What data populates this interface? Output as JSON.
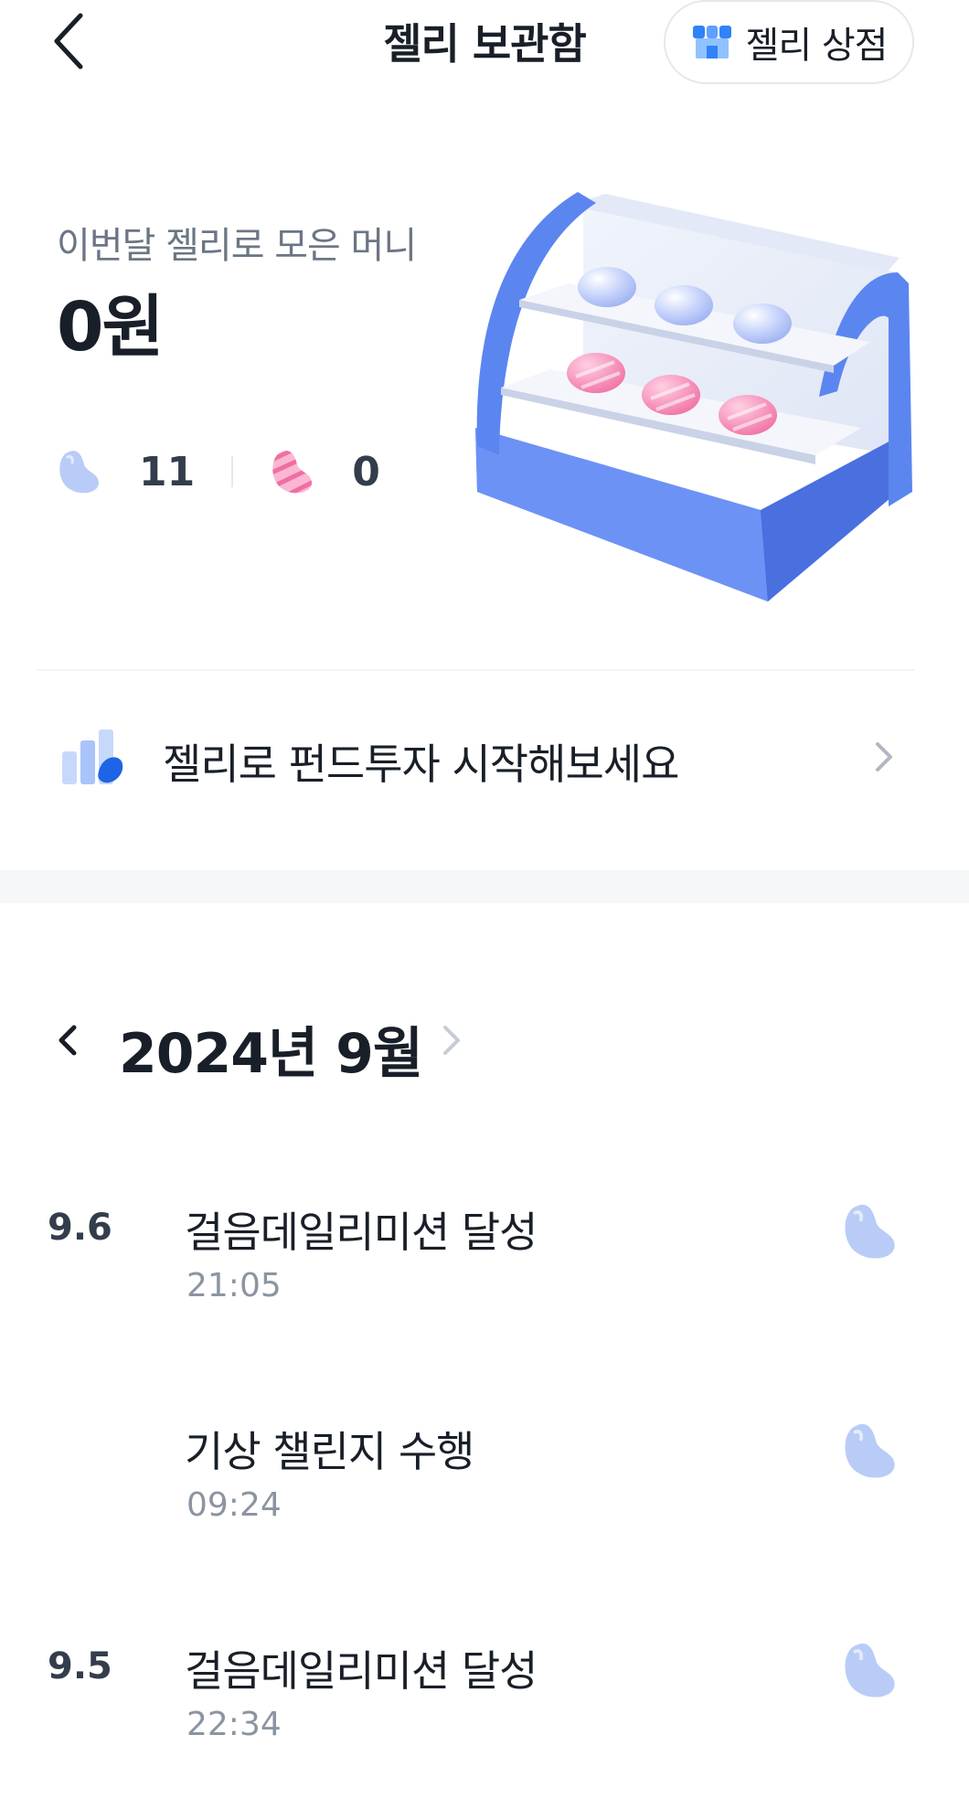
{
  "header": {
    "title": "젤리 보관함",
    "store_button": "젤리 상점"
  },
  "summary": {
    "label": "이번달 젤리로 모은 머니",
    "amount": "0원",
    "blue_jelly_count": "11",
    "pink_jelly_count": "0"
  },
  "fund_banner": {
    "text": "젤리로 펀드투자 시작해보세요"
  },
  "history": {
    "month_title": "2024년 9월",
    "entries": [
      {
        "date": "9.6",
        "title": "걸음데일리미션 달성",
        "time": "21:05",
        "jelly": "blue-jelly-icon"
      },
      {
        "date": "",
        "title": "기상 챌린지 수행",
        "time": "09:24",
        "jelly": "blue-jelly-icon"
      },
      {
        "date": "9.5",
        "title": "걸음데일리미션 달성",
        "time": "22:34",
        "jelly": "blue-jelly-icon"
      }
    ]
  },
  "colors": {
    "accent_blue": "#5b86f0",
    "blue_jelly": "#b9ccf7",
    "pink_jelly": "#f79ac0",
    "text_primary": "#191f28",
    "text_secondary": "#8b95a1"
  }
}
